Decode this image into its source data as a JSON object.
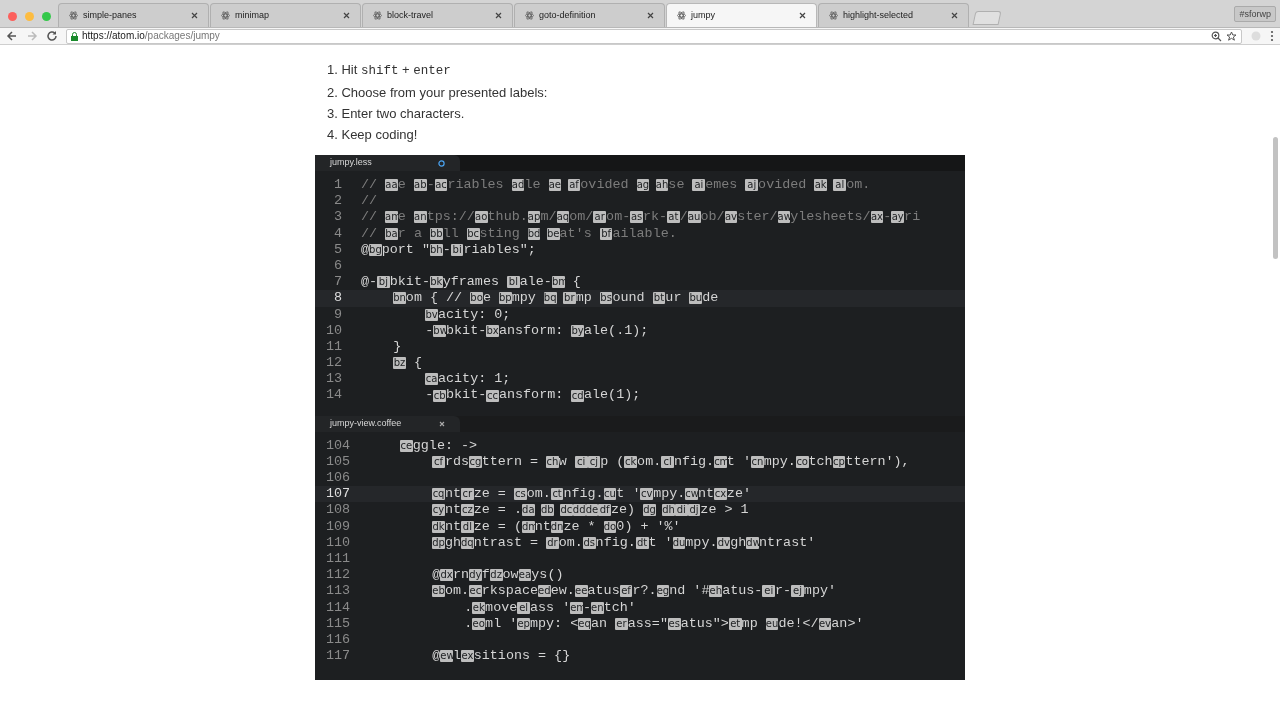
{
  "browser": {
    "tabs": [
      {
        "title": "simple-panes",
        "selected": false
      },
      {
        "title": "minimap",
        "selected": false
      },
      {
        "title": "block-travel",
        "selected": false
      },
      {
        "title": "goto-definition",
        "selected": false
      },
      {
        "title": "jumpy",
        "selected": true
      },
      {
        "title": "highlight-selected",
        "selected": false
      }
    ],
    "profile": "#sforwp",
    "address": {
      "host": "https://atom.io",
      "path": "/packages/jumpy"
    }
  },
  "steps": [
    {
      "number": "1.",
      "parts": [
        {
          "text": "Hit "
        },
        {
          "code": "shift"
        },
        {
          "text": " + "
        },
        {
          "code": "enter"
        }
      ]
    },
    {
      "number": "2.",
      "parts": [
        {
          "text": "Choose from your presented labels:"
        }
      ]
    },
    {
      "number": "3.",
      "parts": [
        {
          "text": "Enter two characters."
        }
      ]
    },
    {
      "number": "4.",
      "parts": [
        {
          "text": "Keep coding!"
        }
      ]
    }
  ],
  "editor": {
    "panes": [
      {
        "tab": "jumpy.less",
        "modified": true,
        "lines": [
          {
            "number": "1",
            "kind": "comment",
            "current": false,
            "segments": [
              {
                "text": "// "
              },
              {
                "label": "aa"
              },
              {
                "text": "e "
              },
              {
                "label": "ab"
              },
              {
                "text": "-"
              },
              {
                "label": "ac"
              },
              {
                "text": "riables "
              },
              {
                "label": "ad"
              },
              {
                "text": "le "
              },
              {
                "label": "ae",
                "spaced": true
              },
              {
                "label": "af"
              },
              {
                "text": "ovided "
              },
              {
                "label": "ag",
                "spaced": true
              },
              {
                "label": "ah"
              },
              {
                "text": "se "
              },
              {
                "label": "ai"
              },
              {
                "text": "emes "
              },
              {
                "label": "aj"
              },
              {
                "text": "ovided "
              },
              {
                "label": "ak",
                "spaced": true
              },
              {
                "label": "al"
              },
              {
                "text": "om."
              }
            ]
          },
          {
            "number": "2",
            "kind": "comment",
            "current": false,
            "segments": [
              {
                "text": "//"
              }
            ]
          },
          {
            "number": "3",
            "kind": "comment",
            "current": false,
            "segments": [
              {
                "text": "// "
              },
              {
                "label": "am"
              },
              {
                "text": "e "
              },
              {
                "label": "an"
              },
              {
                "text": "tps://"
              },
              {
                "label": "ao"
              },
              {
                "text": "thub."
              },
              {
                "label": "ap"
              },
              {
                "text": "m/"
              },
              {
                "label": "aq"
              },
              {
                "text": "om/"
              },
              {
                "label": "ar"
              },
              {
                "text": "om-"
              },
              {
                "label": "as"
              },
              {
                "text": "rk-"
              },
              {
                "label": "at"
              },
              {
                "text": "/"
              },
              {
                "label": "au"
              },
              {
                "text": "ob/"
              },
              {
                "label": "av"
              },
              {
                "text": "ster/"
              },
              {
                "label": "aw"
              },
              {
                "text": "ylesheets/"
              },
              {
                "label": "ax"
              },
              {
                "text": "-"
              },
              {
                "label": "ay"
              },
              {
                "text": "ri"
              }
            ]
          },
          {
            "number": "4",
            "kind": "comment",
            "current": false,
            "segments": [
              {
                "text": "// "
              },
              {
                "label": "ba"
              },
              {
                "text": "r a "
              },
              {
                "label": "bb"
              },
              {
                "text": "ll "
              },
              {
                "label": "bc"
              },
              {
                "text": "sting "
              },
              {
                "label": "bd",
                "spaced": true
              },
              {
                "label": "be"
              },
              {
                "text": "at's "
              },
              {
                "label": "bf"
              },
              {
                "text": "ailable."
              }
            ]
          },
          {
            "number": "5",
            "kind": "code",
            "current": false,
            "segments": [
              {
                "text": "@"
              },
              {
                "label": "bg"
              },
              {
                "text": "port \""
              },
              {
                "label": "bh"
              },
              {
                "text": "-"
              },
              {
                "label": "bi"
              },
              {
                "text": "riables\";"
              }
            ]
          },
          {
            "number": "6",
            "kind": "code",
            "current": false
          },
          {
            "number": "7",
            "kind": "code",
            "current": false,
            "segments": [
              {
                "text": "@-"
              },
              {
                "label": "bj"
              },
              {
                "text": "bkit-"
              },
              {
                "label": "bk"
              },
              {
                "text": "yframes "
              },
              {
                "label": "bl"
              },
              {
                "text": "ale-"
              },
              {
                "label": "bm"
              },
              {
                "text": " {"
              }
            ],
            "children": [
              {
                "number": "8",
                "kind": "code",
                "current": true,
                "segments": [
                  {
                    "label": "bn"
                  },
                  {
                    "text": "om { // "
                  },
                  {
                    "label": "bo"
                  },
                  {
                    "text": "e "
                  },
                  {
                    "label": "bp"
                  },
                  {
                    "text": "mpy "
                  },
                  {
                    "label": "bq",
                    "spaced": true
                  },
                  {
                    "label": "br"
                  },
                  {
                    "text": "mp "
                  },
                  {
                    "label": "bs"
                  },
                  {
                    "text": "ound "
                  },
                  {
                    "label": "bt"
                  },
                  {
                    "text": "ur "
                  },
                  {
                    "label": "bu"
                  },
                  {
                    "text": "de"
                  }
                ],
                "children": [
                  {
                    "number": "9",
                    "kind": "code",
                    "current": false,
                    "segments": [
                      {
                        "label": "bv"
                      },
                      {
                        "text": "acity: 0;"
                      }
                    ]
                  },
                  {
                    "number": "10",
                    "kind": "code",
                    "current": false,
                    "segments": [
                      {
                        "text": "-"
                      },
                      {
                        "label": "bw"
                      },
                      {
                        "text": "bkit-"
                      },
                      {
                        "label": "bx"
                      },
                      {
                        "text": "ansform: "
                      },
                      {
                        "label": "by"
                      },
                      {
                        "text": "ale(.1);"
                      }
                    ]
                  }
                ]
              },
              {
                "number": "11",
                "kind": "code",
                "current": false,
                "segments": [
                  {
                    "text": "}"
                  }
                ]
              },
              {
                "number": "12",
                "kind": "code",
                "current": false,
                "segments": [
                  {
                    "label": "bz"
                  },
                  {
                    "text": " {"
                  }
                ],
                "children": [
                  {
                    "number": "13",
                    "kind": "code",
                    "current": false,
                    "segments": [
                      {
                        "label": "ca"
                      },
                      {
                        "text": "acity: 1;"
                      }
                    ]
                  },
                  {
                    "number": "14",
                    "kind": "code",
                    "current": false,
                    "segments": [
                      {
                        "text": "-"
                      },
                      {
                        "label": "cb"
                      },
                      {
                        "text": "bkit-"
                      },
                      {
                        "label": "cc"
                      },
                      {
                        "text": "ansform: "
                      },
                      {
                        "label": "cd"
                      },
                      {
                        "text": "ale(1);"
                      }
                    ]
                  }
                ]
              }
            ]
          }
        ]
      },
      {
        "tab": "jumpy-view.coffee",
        "modified": false,
        "lines": [
          {
            "number": "104",
            "kind": "code",
            "current": false,
            "segments": [
              {
                "label": "ce"
              },
              {
                "text": "ggle: ->"
              }
            ],
            "children": [
              {
                "number": "105",
                "kind": "code",
                "current": false,
                "segments": [
                  {
                    "label": "cf"
                  },
                  {
                    "text": "rds"
                  },
                  {
                    "label": "cg"
                  },
                  {
                    "text": "ttern = "
                  },
                  {
                    "label": "ch"
                  },
                  {
                    "text": "w "
                  },
                  {
                    "label": "ci"
                  },
                  {
                    "label": "cj"
                  },
                  {
                    "text": "p ("
                  },
                  {
                    "label": "ck"
                  },
                  {
                    "text": "om."
                  },
                  {
                    "label": "cl"
                  },
                  {
                    "text": "nfig."
                  },
                  {
                    "label": "cm"
                  },
                  {
                    "text": "t '"
                  },
                  {
                    "label": "cn"
                  },
                  {
                    "text": "mpy."
                  },
                  {
                    "label": "co"
                  },
                  {
                    "text": "tch"
                  },
                  {
                    "label": "cp"
                  },
                  {
                    "text": "ttern'),"
                  }
                ]
              },
              {
                "number": "106",
                "kind": "code",
                "current": false
              },
              {
                "number": "107",
                "kind": "code",
                "current": true,
                "segments": [
                  {
                    "label": "cq"
                  },
                  {
                    "text": "nt"
                  },
                  {
                    "label": "cr"
                  },
                  {
                    "text": "ze = "
                  },
                  {
                    "label": "cs"
                  },
                  {
                    "text": "om."
                  },
                  {
                    "label": "ct"
                  },
                  {
                    "text": "nfig."
                  },
                  {
                    "label": "cu"
                  },
                  {
                    "text": "t '"
                  },
                  {
                    "label": "cv"
                  },
                  {
                    "text": "mpy."
                  },
                  {
                    "label": "cw"
                  },
                  {
                    "text": "nt"
                  },
                  {
                    "label": "cx"
                  },
                  {
                    "text": "ze'"
                  }
                ]
              },
              {
                "number": "108",
                "kind": "code",
                "current": false,
                "segments": [
                  {
                    "label": "cy"
                  },
                  {
                    "text": "nt"
                  },
                  {
                    "label": "cz"
                  },
                  {
                    "text": "ze = ."
                  },
                  {
                    "label": "da",
                    "spaced": true
                  },
                  {
                    "label": "db",
                    "spaced": true
                  },
                  {
                    "label": "dc"
                  },
                  {
                    "label": "dd"
                  },
                  {
                    "label": "de"
                  },
                  {
                    "label": "df"
                  },
                  {
                    "text": "ze) "
                  },
                  {
                    "label": "dg",
                    "spaced": true
                  },
                  {
                    "label": "dh"
                  },
                  {
                    "label": "di"
                  },
                  {
                    "label": "dj"
                  },
                  {
                    "text": "ze > 1"
                  }
                ]
              },
              {
                "number": "109",
                "kind": "code",
                "current": false,
                "segments": [
                  {
                    "label": "dk"
                  },
                  {
                    "text": "nt"
                  },
                  {
                    "label": "dl"
                  },
                  {
                    "text": "ze = ("
                  },
                  {
                    "label": "dm"
                  },
                  {
                    "text": "nt"
                  },
                  {
                    "label": "dn"
                  },
                  {
                    "text": "ze * "
                  },
                  {
                    "label": "do"
                  },
                  {
                    "text": "0) + '%'"
                  }
                ]
              },
              {
                "number": "110",
                "kind": "code",
                "current": false,
                "segments": [
                  {
                    "label": "dp"
                  },
                  {
                    "text": "gh"
                  },
                  {
                    "label": "dq"
                  },
                  {
                    "text": "ntrast = "
                  },
                  {
                    "label": "dr"
                  },
                  {
                    "text": "om."
                  },
                  {
                    "label": "ds"
                  },
                  {
                    "text": "nfig."
                  },
                  {
                    "label": "dt"
                  },
                  {
                    "text": "t '"
                  },
                  {
                    "label": "du"
                  },
                  {
                    "text": "mpy."
                  },
                  {
                    "label": "dv"
                  },
                  {
                    "text": "gh"
                  },
                  {
                    "label": "dw"
                  },
                  {
                    "text": "ntrast'"
                  }
                ]
              },
              {
                "number": "111",
                "kind": "code",
                "current": false
              },
              {
                "number": "112",
                "kind": "code",
                "current": false,
                "segments": [
                  {
                    "text": "@"
                  },
                  {
                    "label": "dx"
                  },
                  {
                    "text": "rn"
                  },
                  {
                    "label": "dy"
                  },
                  {
                    "text": "f"
                  },
                  {
                    "label": "dz"
                  },
                  {
                    "text": "ow"
                  },
                  {
                    "label": "ea"
                  },
                  {
                    "text": "ys()"
                  }
                ]
              },
              {
                "number": "113",
                "kind": "code",
                "current": false,
                "segments": [
                  {
                    "label": "eb"
                  },
                  {
                    "text": "om."
                  },
                  {
                    "label": "ec"
                  },
                  {
                    "text": "rkspace"
                  },
                  {
                    "label": "ed"
                  },
                  {
                    "text": "ew."
                  },
                  {
                    "label": "ee"
                  },
                  {
                    "text": "atus"
                  },
                  {
                    "label": "ef"
                  },
                  {
                    "text": "r?."
                  },
                  {
                    "label": "eg"
                  },
                  {
                    "text": "nd '#"
                  },
                  {
                    "label": "eh"
                  },
                  {
                    "text": "atus-"
                  },
                  {
                    "label": "ei"
                  },
                  {
                    "text": "r-"
                  },
                  {
                    "label": "ej"
                  },
                  {
                    "text": "mpy'"
                  }
                ],
                "children": [
                  {
                    "number": "114",
                    "kind": "code",
                    "current": false,
                    "segments": [
                      {
                        "text": "."
                      },
                      {
                        "label": "ek"
                      },
                      {
                        "text": "move"
                      },
                      {
                        "label": "el"
                      },
                      {
                        "text": "ass '"
                      },
                      {
                        "label": "em"
                      },
                      {
                        "text": "-"
                      },
                      {
                        "label": "en"
                      },
                      {
                        "text": "tch'"
                      }
                    ]
                  },
                  {
                    "number": "115",
                    "kind": "code",
                    "current": false,
                    "segments": [
                      {
                        "text": "."
                      },
                      {
                        "label": "eo"
                      },
                      {
                        "text": "ml '"
                      },
                      {
                        "label": "ep"
                      },
                      {
                        "text": "mpy: <"
                      },
                      {
                        "label": "eq"
                      },
                      {
                        "text": "an "
                      },
                      {
                        "label": "er"
                      },
                      {
                        "text": "ass=\""
                      },
                      {
                        "label": "es"
                      },
                      {
                        "text": "atus\">"
                      },
                      {
                        "label": "et"
                      },
                      {
                        "text": "mp "
                      },
                      {
                        "label": "eu"
                      },
                      {
                        "text": "de!</"
                      },
                      {
                        "label": "ev"
                      },
                      {
                        "text": "an>'"
                      }
                    ]
                  }
                ]
              },
              {
                "number": "116",
                "kind": "code",
                "current": false
              },
              {
                "number": "117",
                "kind": "code",
                "current": false,
                "segments": [
                  {
                    "text": "@"
                  },
                  {
                    "label": "ew"
                  },
                  {
                    "text": "l"
                  },
                  {
                    "label": "ex"
                  },
                  {
                    "text": "sitions = {}"
                  }
                ]
              }
            ]
          }
        ]
      }
    ]
  }
}
